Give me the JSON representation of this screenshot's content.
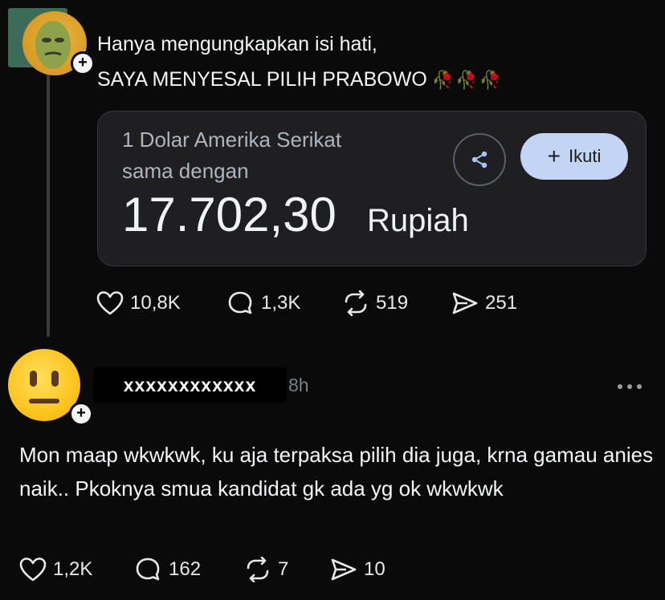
{
  "post": {
    "text_line1": "Hanya mengungkapkan isi hati,",
    "text_line2": "SAYA MENYESAL PILIH PRABOWO",
    "emoji": "🥀🥀🥀",
    "card": {
      "label_line1": "1 Dolar Amerika Serikat",
      "label_line2": "sama dengan",
      "amount": "17.702,30",
      "unit": "Rupiah",
      "share_icon": "share-icon",
      "follow_plus": "+",
      "follow_label": "Ikuti"
    },
    "actions": {
      "likes": "10,8K",
      "comments": "1,3K",
      "reposts": "519",
      "shares": "251"
    }
  },
  "reply": {
    "username": "xxxxxxxxxxxx",
    "time": "8h",
    "more": "•••",
    "text": "Mon maap wkwkwk, ku aja terpaksa pilih dia juga, krna gamau anies naik.. Pkoknya smua kandidat gk ada yg ok wkwkwk",
    "actions": {
      "likes": "1,2K",
      "comments": "162",
      "reposts": "7",
      "shares": "10"
    }
  },
  "colors": {
    "background": "#0a0a0a",
    "card": "#1f1f22",
    "follow_button": "#c4d4f5",
    "muted_text": "#7c7f84"
  }
}
